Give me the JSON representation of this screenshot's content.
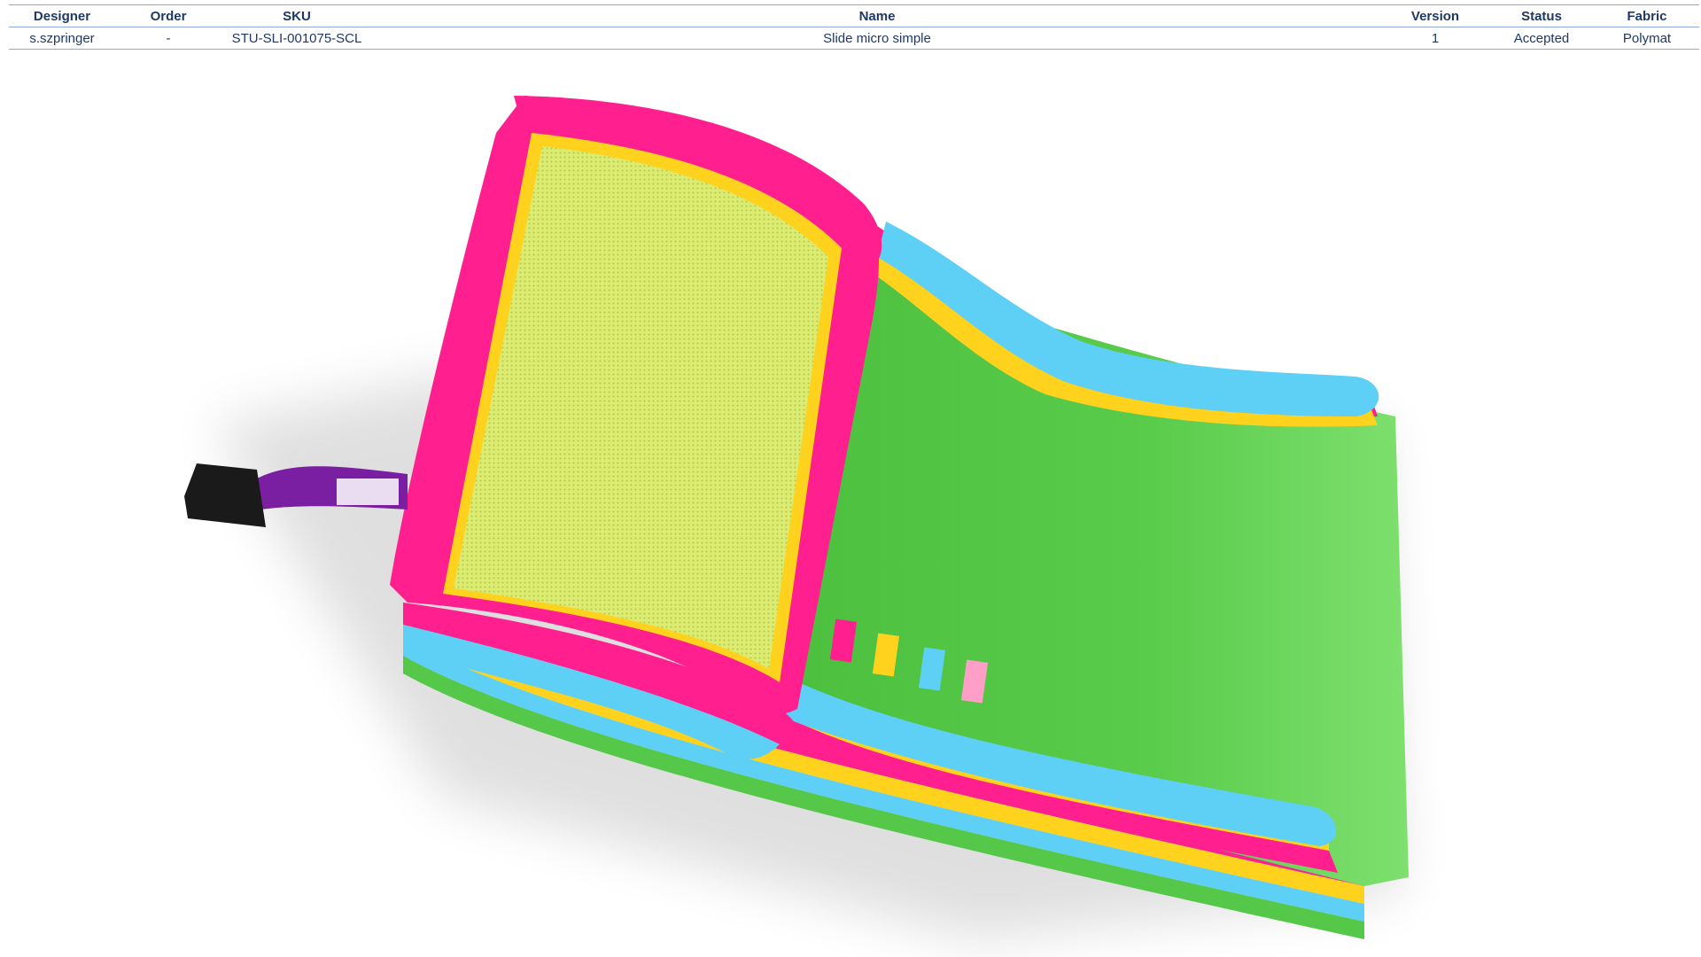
{
  "table": {
    "headers": [
      "Designer",
      "Order",
      "SKU",
      "Name",
      "Version",
      "Status",
      "Fabric"
    ],
    "row": {
      "designer": "s.szpringer",
      "order": "-",
      "sku": "STU-SLI-001075-SCL",
      "name": "Slide micro simple",
      "version": "1",
      "status": "Accepted",
      "fabric": "Polymat"
    }
  },
  "render": {
    "colors": {
      "pink": "#ff1f8e",
      "blue": "#5fd0f5",
      "yellow": "#ffd21e",
      "green": "#55c84a",
      "mesh": "#c8e66a",
      "blower": "#1a1a1a",
      "tube": "#7a1fa2"
    }
  }
}
